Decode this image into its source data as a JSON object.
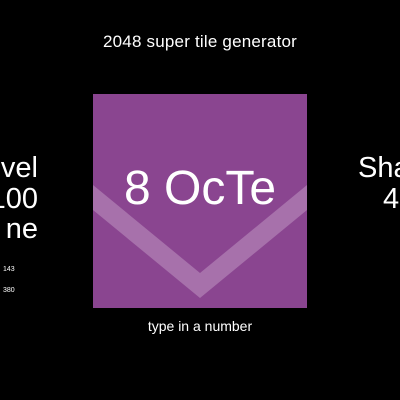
{
  "header": {
    "title": "2048 super tile generator"
  },
  "tile": {
    "label": "8 OcTe",
    "background": "#8a4590",
    "chevron_color": "#a771ab"
  },
  "input": {
    "hint": "type in a number"
  },
  "left_panel": {
    "line1": "Level",
    "line2": "100",
    "line3": "ne",
    "stat1": "143",
    "stat2": "380"
  },
  "right_panel": {
    "line1": "Sha",
    "line2": "4"
  }
}
